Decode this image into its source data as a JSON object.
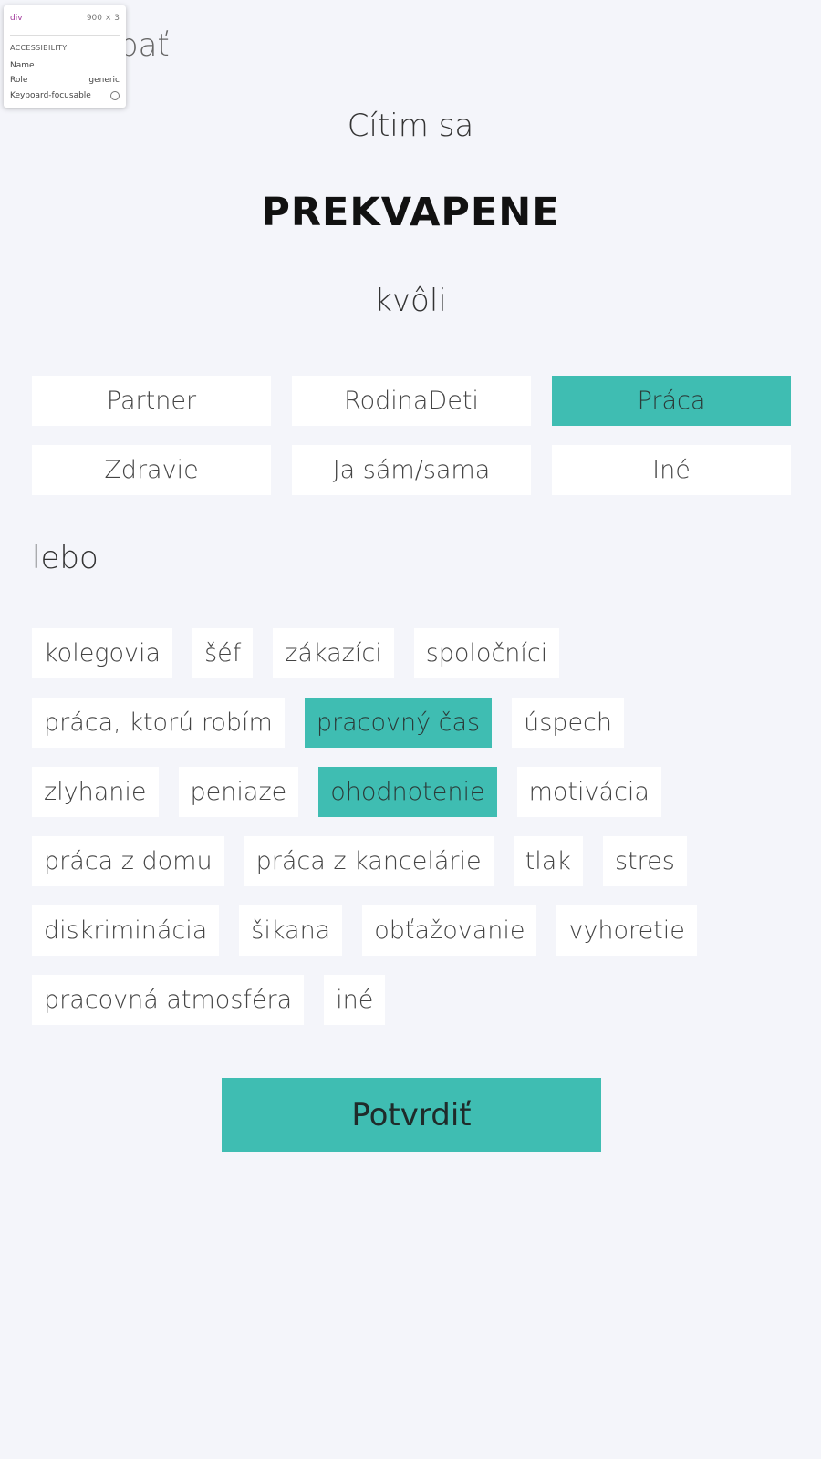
{
  "header": {
    "back_text": "pať"
  },
  "devtools_tooltip": {
    "tag": "div",
    "size": "900 × 3",
    "section": "ACCESSIBILITY",
    "name_label": "Name",
    "role_label": "Role",
    "role_value": "generic",
    "keyboard_label": "Keyboard-focusable"
  },
  "feel_label": "Cítim sa",
  "emotion": "PREKVAPENE",
  "because_label": "kvôli",
  "categories": [
    {
      "label": "Partner",
      "selected": false
    },
    {
      "label": "RodinaDeti",
      "selected": false
    },
    {
      "label": "Práca",
      "selected": true
    },
    {
      "label": "Zdravie",
      "selected": false
    },
    {
      "label": "Ja sám/sama",
      "selected": false
    },
    {
      "label": "Iné",
      "selected": false
    }
  ],
  "or_label": "lebo",
  "tag_rows": [
    [
      {
        "label": "kolegovia",
        "selected": false
      },
      {
        "label": "šéf",
        "selected": false
      },
      {
        "label": "zákazíci",
        "selected": false
      },
      {
        "label": "spoločníci",
        "selected": false
      }
    ],
    [
      {
        "label": "práca, ktorú robím",
        "selected": false
      },
      {
        "label": "pracovný čas",
        "selected": true
      },
      {
        "label": "úspech",
        "selected": false
      }
    ],
    [
      {
        "label": "zlyhanie",
        "selected": false
      },
      {
        "label": "peniaze",
        "selected": false
      },
      {
        "label": "ohodnotenie",
        "selected": true
      },
      {
        "label": "motivácia",
        "selected": false
      }
    ],
    [
      {
        "label": "práca z domu",
        "selected": false
      },
      {
        "label": "práca z kancelárie",
        "selected": false
      },
      {
        "label": "tlak",
        "selected": false
      },
      {
        "label": "stres",
        "selected": false
      }
    ],
    [
      {
        "label": "diskriminácia",
        "selected": false
      },
      {
        "label": "šikana",
        "selected": false
      },
      {
        "label": "obťažovanie",
        "selected": false
      },
      {
        "label": "vyhoretie",
        "selected": false
      }
    ],
    [
      {
        "label": "pracovná atmosféra",
        "selected": false
      },
      {
        "label": "iné",
        "selected": false
      }
    ]
  ],
  "confirm_label": "Potvrdiť",
  "colors": {
    "accent": "#3fbdb2",
    "background": "#f4f5fa",
    "chip": "#ffffff"
  }
}
